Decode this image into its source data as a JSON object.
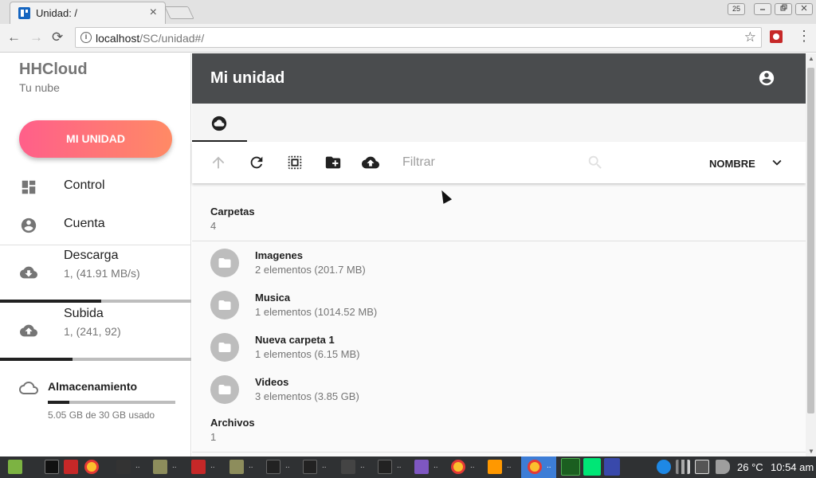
{
  "browser": {
    "tab_title": "Unidad: /",
    "tab_close": "×",
    "window_badge": "25",
    "url_host": "localhost",
    "url_path": "/SC/unidad#/",
    "back_glyph": "←",
    "forward_glyph": "→",
    "reload_glyph": "⟳",
    "info_glyph": "i",
    "star_glyph": "☆",
    "menu_glyph": "⋮"
  },
  "sidebar": {
    "brand": "HHCloud",
    "tagline": "Tu nube",
    "primary_button": "MI UNIDAD",
    "nav": [
      {
        "label": "Control",
        "icon": "dashboard-icon"
      },
      {
        "label": "Cuenta",
        "icon": "account-circle-icon"
      }
    ],
    "download": {
      "title": "Descarga",
      "detail": "1, (41.91 MB/s)",
      "progress": 0.53
    },
    "upload": {
      "title": "Subida",
      "detail": "1, (241, 92)",
      "progress": 0.38
    },
    "storage": {
      "title": "Almacenamiento",
      "usage_text": "5.05 GB de 30 GB usado",
      "used_fraction": 0.168
    }
  },
  "main": {
    "title": "Mi unidad",
    "filter_placeholder": "Filtrar",
    "sort_label": "NOMBRE",
    "folders_section": {
      "title": "Carpetas",
      "count": "4"
    },
    "folders": [
      {
        "name": "Imagenes",
        "meta": "2 elementos (201.7 MB)"
      },
      {
        "name": "Musica",
        "meta": "1 elementos (1014.52 MB)"
      },
      {
        "name": "Nueva carpeta 1",
        "meta": "1 elementos (6.15 MB)"
      },
      {
        "name": "Videos",
        "meta": "3 elementos (3.85 GB)"
      }
    ],
    "files_section": {
      "title": "Archivos",
      "count": "1"
    }
  },
  "taskbar": {
    "temperature": "26 °C",
    "clock": "10:54 am",
    "dots": ".."
  },
  "colors": {
    "accent_gradient_start": "#ff5f8a",
    "accent_gradient_end": "#ff8a65",
    "appbar": "#4a4c4e",
    "taskbar": "#2f3133"
  }
}
